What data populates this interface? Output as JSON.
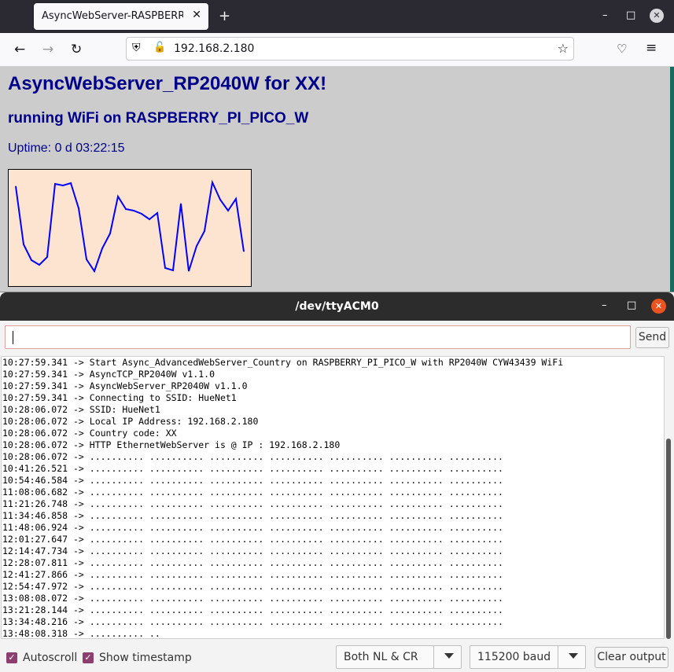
{
  "browser": {
    "tab_title": "AsyncWebServer-RASPBERRY_PI_PICO_W",
    "tab_close": "✕",
    "new_tab": "+",
    "url": "192.168.2.180"
  },
  "page": {
    "heading": "AsyncWebServer_RP2040W for XX!",
    "subheading": "running WiFi on RASPBERRY_PI_PICO_W",
    "uptime": "Uptime: 0 d 03:22:15"
  },
  "chart_data": {
    "type": "line",
    "title": "",
    "xlabel": "",
    "ylabel": "",
    "line_color": "#0000ff",
    "background": "#fce4d0",
    "x": [
      0,
      1,
      2,
      3,
      4,
      5,
      6,
      7,
      8,
      9,
      10,
      11,
      12,
      13,
      14,
      15,
      16,
      17,
      18,
      19,
      20,
      21,
      22,
      23,
      24,
      25,
      26,
      27,
      28,
      29
    ],
    "values": [
      128,
      54,
      34,
      28,
      38,
      131,
      129,
      132,
      100,
      35,
      20,
      49,
      68,
      115,
      99,
      97,
      93,
      86,
      94,
      24,
      21,
      106,
      20,
      52,
      71,
      133,
      111,
      97,
      112,
      45
    ],
    "ylim": [
      0,
      150
    ]
  },
  "serial": {
    "title": "/dev/ttyACM0",
    "input_value": "",
    "send_label": "Send",
    "log_lines": [
      "10:27:59.341 -> Start Async_AdvancedWebServer_Country on RASPBERRY_PI_PICO_W with RP2040W CYW43439 WiFi",
      "10:27:59.341 -> AsyncTCP_RP2040W v1.1.0",
      "10:27:59.341 -> AsyncWebServer_RP2040W v1.1.0",
      "10:27:59.341 -> Connecting to SSID: HueNet1",
      "10:28:06.072 -> SSID: HueNet1",
      "10:28:06.072 -> Local IP Address: 192.168.2.180",
      "10:28:06.072 -> Country code: XX",
      "10:28:06.072 -> HTTP EthernetWebServer is @ IP : 192.168.2.180",
      "10:28:06.072 -> .......... .......... .......... .......... .......... .......... ..........",
      "10:41:26.521 -> .......... .......... .......... .......... .......... .......... ..........",
      "10:54:46.584 -> .......... .......... .......... .......... .......... .......... ..........",
      "11:08:06.682 -> .......... .......... .......... .......... .......... .......... ..........",
      "11:21:26.748 -> .......... .......... .......... .......... .......... .......... ..........",
      "11:34:46.858 -> .......... .......... .......... .......... .......... .......... ..........",
      "11:48:06.924 -> .......... .......... .......... .......... .......... .......... ..........",
      "12:01:27.647 -> .......... .......... .......... .......... .......... .......... ..........",
      "12:14:47.734 -> .......... .......... .......... .......... .......... .......... ..........",
      "12:28:07.811 -> .......... .......... .......... .......... .......... .......... ..........",
      "12:41:27.866 -> .......... .......... .......... .......... .......... .......... ..........",
      "12:54:47.972 -> .......... .......... .......... .......... .......... .......... ..........",
      "13:08:08.072 -> .......... .......... .......... .......... .......... .......... ..........",
      "13:21:28.144 -> .......... .......... .......... .......... .......... .......... ..........",
      "13:34:48.216 -> .......... .......... .......... .......... .......... .......... ..........",
      "13:48:08.318 -> .......... .."
    ],
    "autoscroll_label": "Autoscroll",
    "autoscroll_checked": true,
    "timestamp_label": "Show timestamp",
    "timestamp_checked": true,
    "line_ending": "Both NL & CR",
    "baud": "115200 baud",
    "clear_label": "Clear output"
  },
  "colors": {
    "heading": "#000088",
    "checkbox": "#8c3f6e",
    "close_button": "#e95420"
  }
}
